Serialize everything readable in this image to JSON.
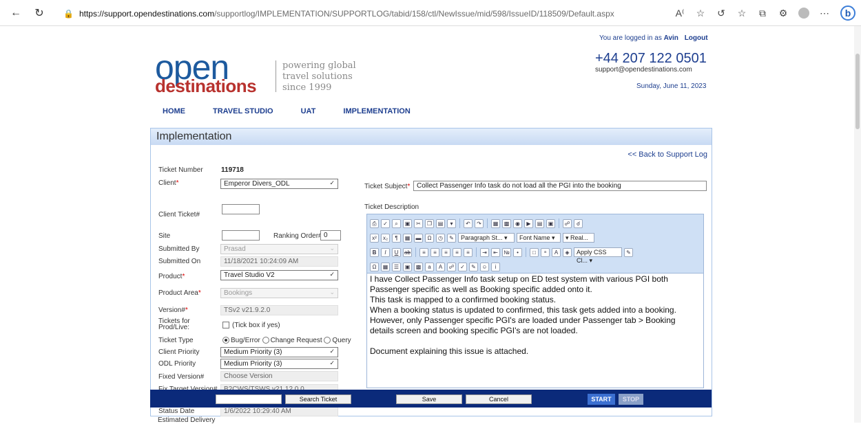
{
  "browser": {
    "url_host": "https://support.opendestinations.com",
    "url_path": "/supportlog/IMPLEMENTATION/SUPPORTLOG/tabid/158/ctl/NewIssue/mid/598/IssueID/118509/Default.aspx"
  },
  "header": {
    "login_prefix": "You are logged in as",
    "user": "Avin",
    "logout": "Logout",
    "phone": "+44 207 122 0501",
    "email": "support@opendestinations.com",
    "date": "Sunday, June 11, 2023",
    "logo_open": "open",
    "logo_destinations": "destinations",
    "tagline": [
      "powering global",
      "travel solutions",
      "since 1999"
    ]
  },
  "nav": [
    "HOME",
    "TRAVEL STUDIO",
    "UAT",
    "IMPLEMENTATION"
  ],
  "panel": {
    "title": "Implementation",
    "back_link": "<< Back to Support Log"
  },
  "form": {
    "ticket_number_label": "Ticket Number",
    "ticket_number": "119718",
    "client_label": "Client",
    "client": "Emperor Divers_ODL",
    "client_ticket_label": "Client Ticket#",
    "site_label": "Site",
    "ranking_label": "Ranking Order#",
    "ranking_value": "0",
    "submitted_by_label": "Submitted By",
    "submitted_by": "Prasad",
    "submitted_on_label": "Submitted On",
    "submitted_on": "11/18/2021 10:24:09 AM",
    "product_label": "Product",
    "product": "Travel Studio V2",
    "product_area_label": "Product Area",
    "product_area": "Bookings",
    "version_label": "Version#",
    "version": "TSv2 v21.9.2.0",
    "tickets_prod_label_1": "Tickets for",
    "tickets_prod_label_2": "Prod/Live:",
    "tickets_prod_check": "(Tick box if yes)",
    "ticket_type_label": "Ticket Type",
    "ticket_type_options": [
      "Bug/Error",
      "Change Request",
      "Query"
    ],
    "client_priority_label": "Client Priority",
    "client_priority": "Medium Priority (3)",
    "odl_priority_label": "ODL Priority",
    "odl_priority": "Medium Priority (3)",
    "fixed_version_label": "Fixed Version#",
    "fixed_version": "Choose Version",
    "fix_target_label": "Fix Target Version#",
    "fix_target": "B2CWS/TSWS v21.12.0.0",
    "status_date_label": "Status Date",
    "status_date": "1/6/2022 10:29:40 AM",
    "estimated_delivery_label": "Estimated Delivery",
    "subject_label": "Ticket Subject",
    "subject": "Collect Passenger Info task do not load all the PGI into the booking",
    "description_label": "Ticket Description"
  },
  "editor": {
    "paragraph_style": "Paragraph St...",
    "font_name": "Font Name",
    "font_size": "Real...",
    "css_class": "Apply CSS Cl...",
    "body": [
      "I have Collect Passenger Info task setup on ED test system with various PGI both Passenger specific as well as Booking specific added onto it.",
      "This task is mapped to a confirmed booking status.",
      "When a booking status is updated to confirmed, this task gets added into a booking. However, only Passenger specific PGI's are loaded under Passenger tab > Booking details screen and booking specific PGI's are not loaded.",
      "",
      "Document explaining this issue is attached."
    ]
  },
  "actions": {
    "search_ticket": "Search Ticket",
    "save": "Save",
    "cancel": "Cancel",
    "start": "START",
    "stop": "STOP"
  }
}
